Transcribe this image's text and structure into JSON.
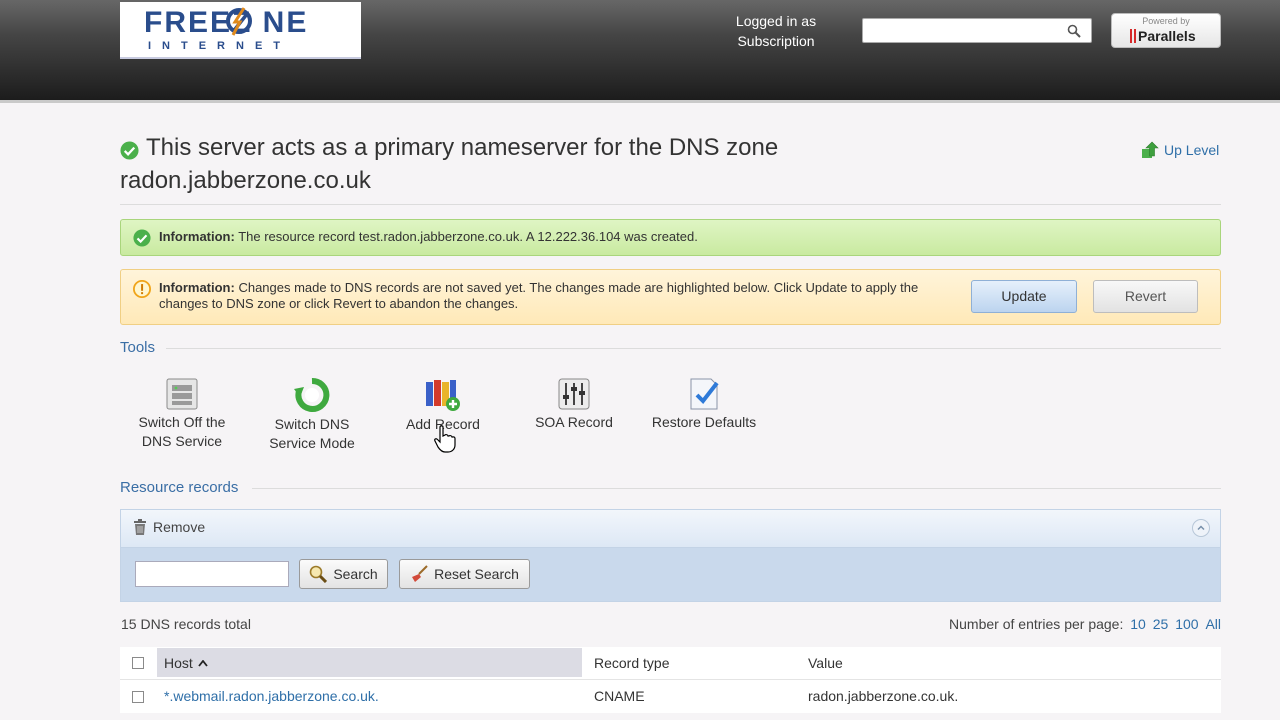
{
  "header": {
    "logo_main": "FREEZ NE",
    "logo_sub": "INTERNET",
    "login_line1": "Logged in as",
    "login_line2": "Subscription",
    "search_placeholder": "",
    "powered_by": "Powered by",
    "brand": "Parallels"
  },
  "page": {
    "title": "This server acts as a primary nameserver for the DNS zone radon.jabberzone.co.uk",
    "up_level": "Up Level"
  },
  "messages": {
    "success_label": "Information:",
    "success_text": "The resource record test.radon.jabberzone.co.uk. A 12.222.36.104 was created.",
    "warning_label": "Information:",
    "warning_text": "Changes made to DNS records are not saved yet. The changes made are highlighted below. Click Update to apply the changes to DNS zone or click Revert to abandon the changes.",
    "update_button": "Update",
    "revert_button": "Revert"
  },
  "tools": {
    "heading": "Tools",
    "items": [
      {
        "line1": "Switch Off the",
        "line2": "DNS Service"
      },
      {
        "line1": "Switch DNS",
        "line2": "Service Mode"
      },
      {
        "line1": "Add Record",
        "line2": ""
      },
      {
        "line1": "SOA Record",
        "line2": ""
      },
      {
        "line1": "Restore Defaults",
        "line2": ""
      }
    ]
  },
  "records": {
    "heading": "Resource records",
    "remove": "Remove",
    "search_value": "",
    "search_button": "Search",
    "reset_button": "Reset Search",
    "total": "15 DNS records total",
    "per_page_label": "Number of entries per page:",
    "per_page_options": [
      "10",
      "25",
      "100",
      "All"
    ],
    "columns": {
      "host": "Host",
      "type": "Record type",
      "value": "Value"
    },
    "rows": [
      {
        "host": "*.webmail.radon.jabberzone.co.uk.",
        "type": "CNAME",
        "value": "radon.jabberzone.co.uk."
      }
    ]
  },
  "colors": {
    "accent": "#2f6fa8",
    "success": "#4bb04b",
    "warning": "#f0a418"
  }
}
